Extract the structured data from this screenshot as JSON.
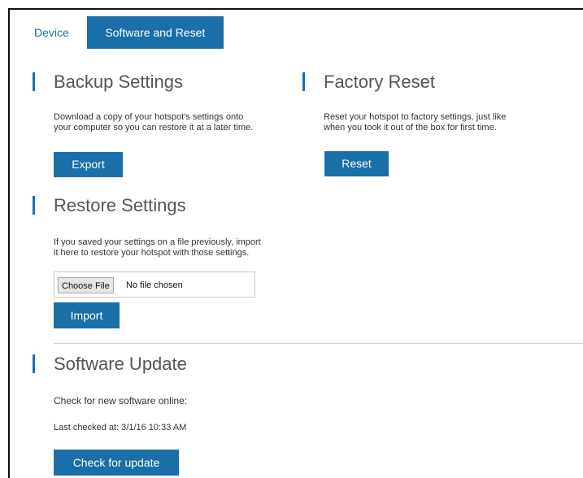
{
  "tabs": [
    {
      "label": "Device"
    },
    {
      "label": "Software and Reset"
    }
  ],
  "backup": {
    "title": "Backup Settings",
    "description_line1": "Download a copy of your hotspot's settings onto",
    "description_line2": "your computer so you can restore it at a later time.",
    "button": "Export"
  },
  "factory": {
    "title": "Factory Reset",
    "description_line1": "Reset your hotspot to factory settings, just like",
    "description_line2": "when you took it out of the box for first time.",
    "button": "Reset"
  },
  "restore": {
    "title": "Restore Settings",
    "description_line1": "If you saved your settings on a file previously, import",
    "description_line2": "it here to restore your hotspot with those settings.",
    "file_button": "Choose File",
    "file_status": "No file chosen",
    "button": "Import"
  },
  "update": {
    "title": "Software Update",
    "check_label": "Check for new software online:",
    "last_checked": "Last checked at: 3/1/16 10:33 AM",
    "button": "Check for update"
  },
  "colors": {
    "accent": "#1a6fa8",
    "text": "#333333",
    "title": "#555555"
  }
}
